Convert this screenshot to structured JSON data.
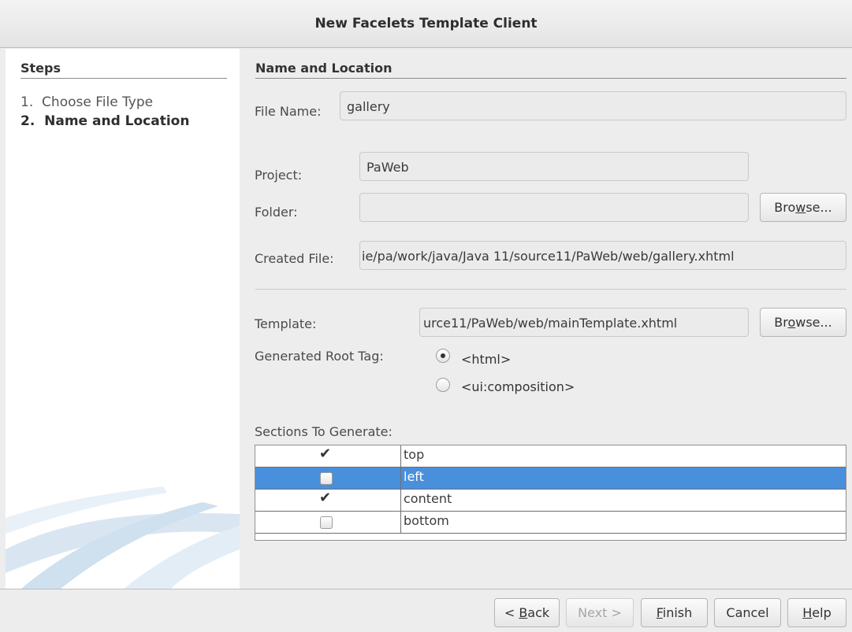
{
  "window": {
    "title": "New Facelets Template Client"
  },
  "steps": {
    "heading": "Steps",
    "items": [
      {
        "number": "1.",
        "label": "Choose File Type"
      },
      {
        "number": "2.",
        "label": "Name and Location"
      }
    ]
  },
  "form": {
    "section_title": "Name and Location",
    "file_name": {
      "label": "File Name:",
      "value": "gallery"
    },
    "project": {
      "label": "Project:",
      "value": "PaWeb"
    },
    "folder": {
      "label": "Folder:",
      "value": ""
    },
    "folder_browse": {
      "pre": "Bro",
      "mnemonic": "w",
      "post": "se..."
    },
    "created_file": {
      "label": "Created File:",
      "value": "ie/pa/work/java/Java 11/source11/PaWeb/web/gallery.xhtml"
    },
    "template": {
      "label": "Template:",
      "value": "urce11/PaWeb/web/mainTemplate.xhtml"
    },
    "template_browse": {
      "pre": "Br",
      "mnemonic": "o",
      "post": "wse..."
    },
    "root_tag": {
      "label": "Generated Root Tag:",
      "options": [
        "<html>",
        "<ui:composition>"
      ],
      "selected": "<html>"
    },
    "sections": {
      "label": "Sections To Generate:",
      "rows": [
        {
          "name": "top",
          "checked": true,
          "selected": false
        },
        {
          "name": "left",
          "checked": false,
          "selected": true
        },
        {
          "name": "content",
          "checked": true,
          "selected": false
        },
        {
          "name": "bottom",
          "checked": false,
          "selected": false
        }
      ]
    }
  },
  "footer": {
    "back": {
      "pre": "< ",
      "mnemonic": "B",
      "post": "ack"
    },
    "next": "Next >",
    "finish": {
      "mnemonic": "F",
      "post": "inish"
    },
    "cancel": "Cancel",
    "help": {
      "mnemonic": "H",
      "post": "elp"
    }
  }
}
